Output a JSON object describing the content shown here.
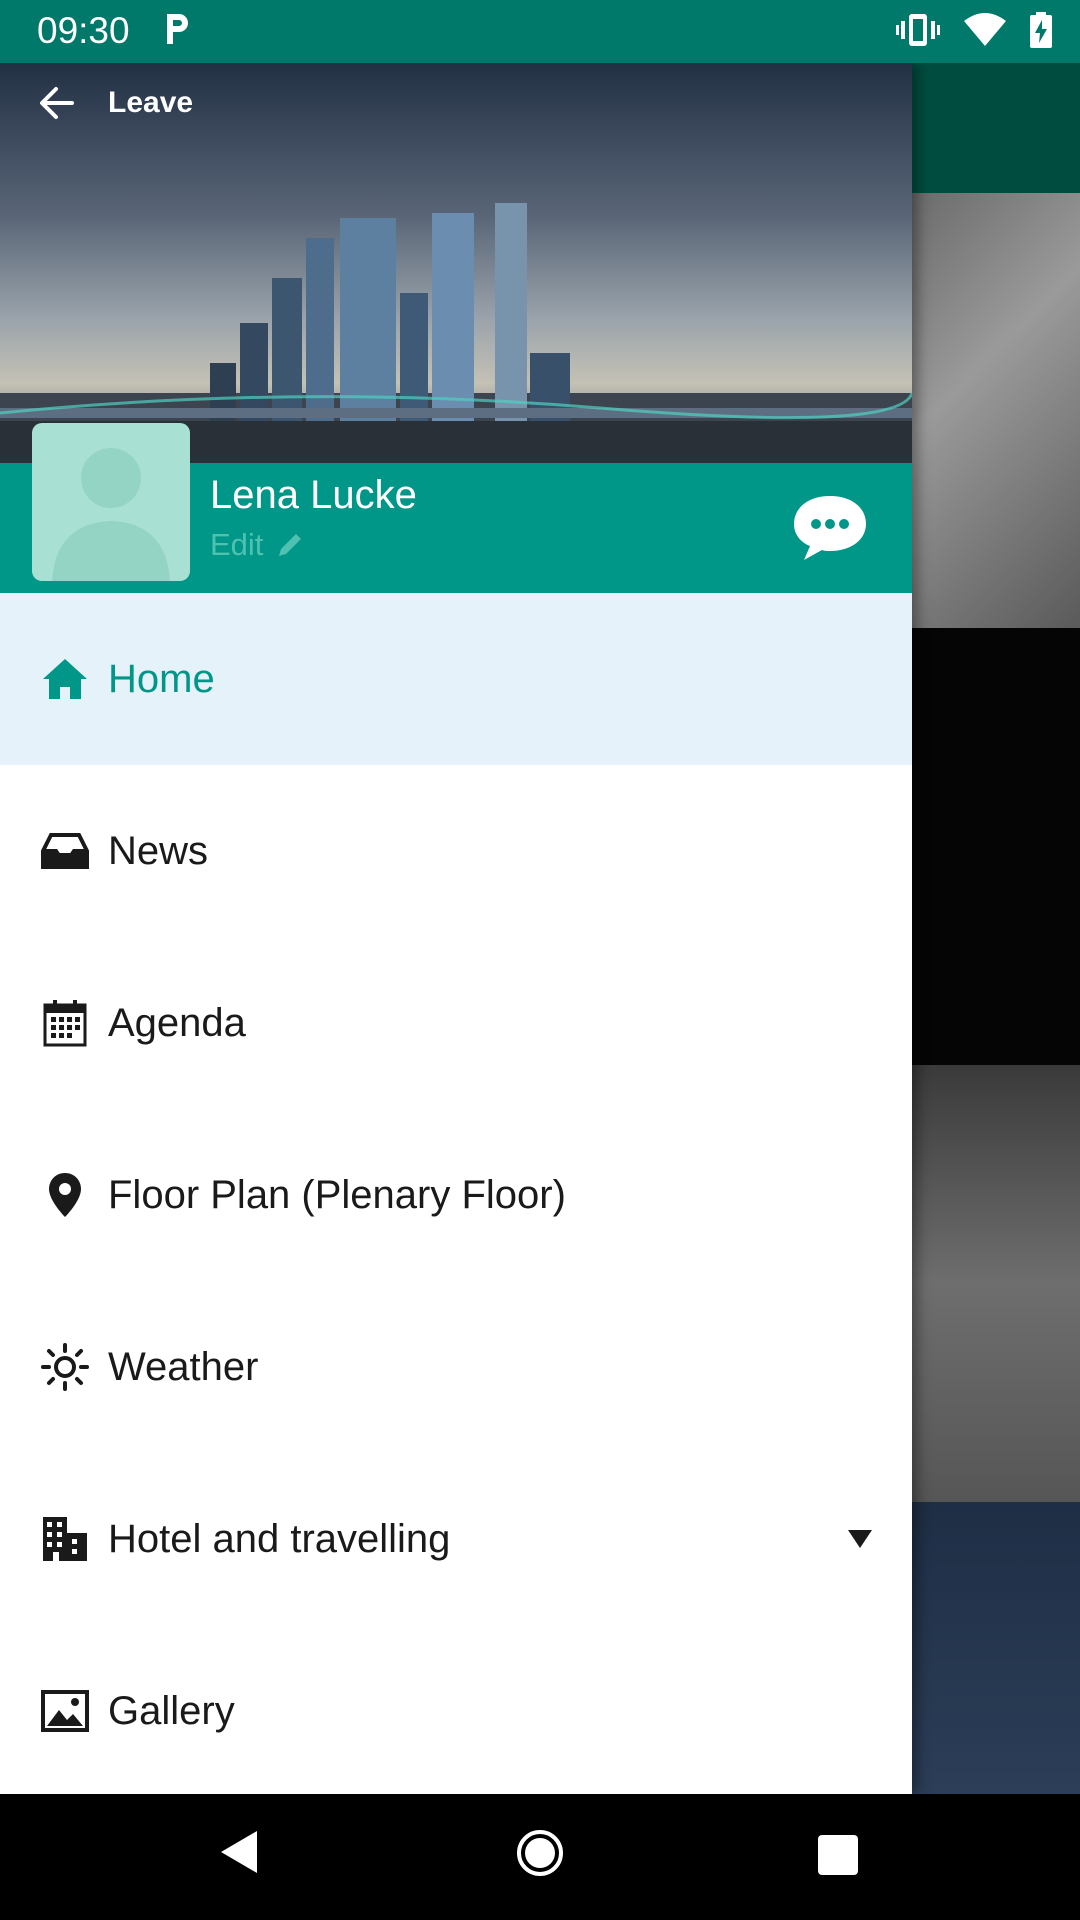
{
  "status_bar": {
    "time": "09:30",
    "icons": [
      "parking-icon",
      "vibrate-icon",
      "wifi-icon",
      "battery-charging-icon"
    ]
  },
  "drawer": {
    "leave_label": "Leave",
    "user": {
      "name": "Lena Lucke",
      "edit_label": "Edit"
    },
    "menu_items": [
      {
        "label": "Home",
        "icon": "home-icon",
        "active": true
      },
      {
        "label": "News",
        "icon": "inbox-icon",
        "active": false
      },
      {
        "label": "Agenda",
        "icon": "calendar-icon",
        "active": false
      },
      {
        "label": "Floor Plan (Plenary Floor)",
        "icon": "map-pin-icon",
        "active": false
      },
      {
        "label": "Weather",
        "icon": "sun-icon",
        "active": false
      },
      {
        "label": "Hotel and travelling",
        "icon": "buildings-icon",
        "active": false,
        "expandable": true
      },
      {
        "label": "Gallery",
        "icon": "image-icon",
        "active": false
      }
    ]
  },
  "colors": {
    "status_bar": "#00796b",
    "profile_bar": "#009688",
    "active_item_bg": "#e6f2f9",
    "active_item_text": "#009688"
  }
}
